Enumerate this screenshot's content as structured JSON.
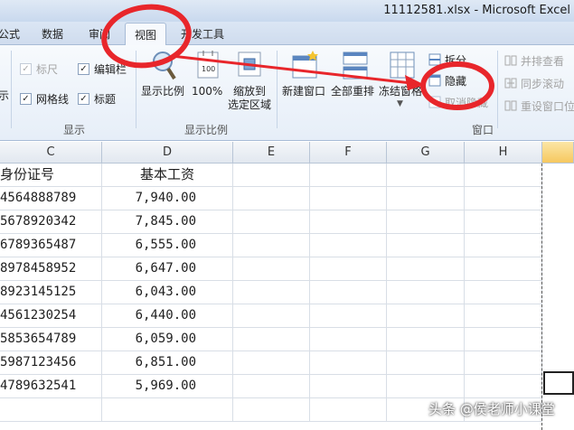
{
  "window": {
    "title": "11112581.xlsx - Microsoft Excel"
  },
  "tabs": [
    {
      "label": "公式"
    },
    {
      "label": "数据"
    },
    {
      "label": "审阅"
    },
    {
      "label": "视图",
      "active": true
    },
    {
      "label": "开发工具"
    }
  ],
  "ribbon": {
    "show_group": {
      "label": "显示",
      "partial_label": "示",
      "ruler": "标尺",
      "formula_bar": "编辑栏",
      "gridlines": "网格线",
      "headings": "标题"
    },
    "zoom_group": {
      "label": "显示比例",
      "zoom": "显示比例",
      "zoom_100": "100%",
      "zoom_100_icon_text": "100",
      "zoom_selection": "缩放到\n选定区域"
    },
    "window_group": {
      "label": "窗口",
      "new_window": "新建窗口",
      "arrange_all": "全部重排",
      "freeze_panes": "冻结窗格",
      "split": "拆分",
      "hide": "隐藏",
      "unhide": "取消隐藏",
      "side_by_side": "并排查看",
      "sync_scroll": "同步滚动",
      "reset_position": "重设窗口位"
    }
  },
  "sheet": {
    "columns": [
      "C",
      "D",
      "E",
      "F",
      "G",
      "H"
    ],
    "header_row": [
      "身份证号",
      "基本工资"
    ],
    "rows": [
      [
        "4564888789",
        "7,940.00"
      ],
      [
        "5678920342",
        "7,845.00"
      ],
      [
        "6789365487",
        "6,555.00"
      ],
      [
        "8978458952",
        "6,647.00"
      ],
      [
        "8923145125",
        "6,043.00"
      ],
      [
        "4561230254",
        "6,440.00"
      ],
      [
        "5853654789",
        "6,059.00"
      ],
      [
        "5987123456",
        "6,851.00"
      ],
      [
        "4789632541",
        "5,969.00"
      ],
      [
        "",
        ""
      ]
    ]
  },
  "watermark": "头条 @侯老师小课堂",
  "colors": {
    "annotation": "#e8262b",
    "selected_column": "#f6c85f"
  }
}
